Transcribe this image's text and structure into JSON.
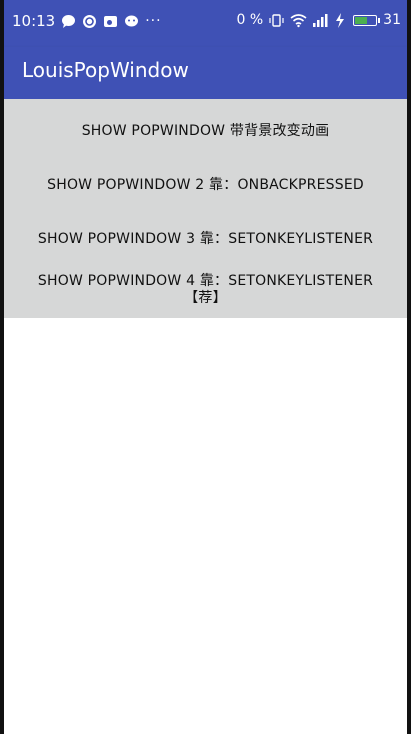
{
  "status_bar": {
    "time": "10:13",
    "left_icons": [
      "chat-bubble-icon",
      "sync-icon",
      "weibo-icon",
      "wechat-icon"
    ],
    "more_dots": "···",
    "net_speed": "0 %",
    "battery_level": "31",
    "colors": {
      "bar": "#3f51b5",
      "battery_fill": "#4caf50"
    }
  },
  "toolbar": {
    "title": "LouisPopWindow"
  },
  "buttons": [
    {
      "label": "SHOW POPWINDOW 带背景改变动画"
    },
    {
      "label": "SHOW POPWINDOW 2 靠：ONBACKPRESSED"
    },
    {
      "label": "SHOW POPWINDOW 3 靠：SETONKEYLISTENER"
    },
    {
      "label": "SHOW POPWINDOW 4 靠：SETONKEYLISTENER 【荐】"
    }
  ],
  "colors": {
    "button_area_bg": "#d6d7d7",
    "content_bg": "#ffffff"
  }
}
